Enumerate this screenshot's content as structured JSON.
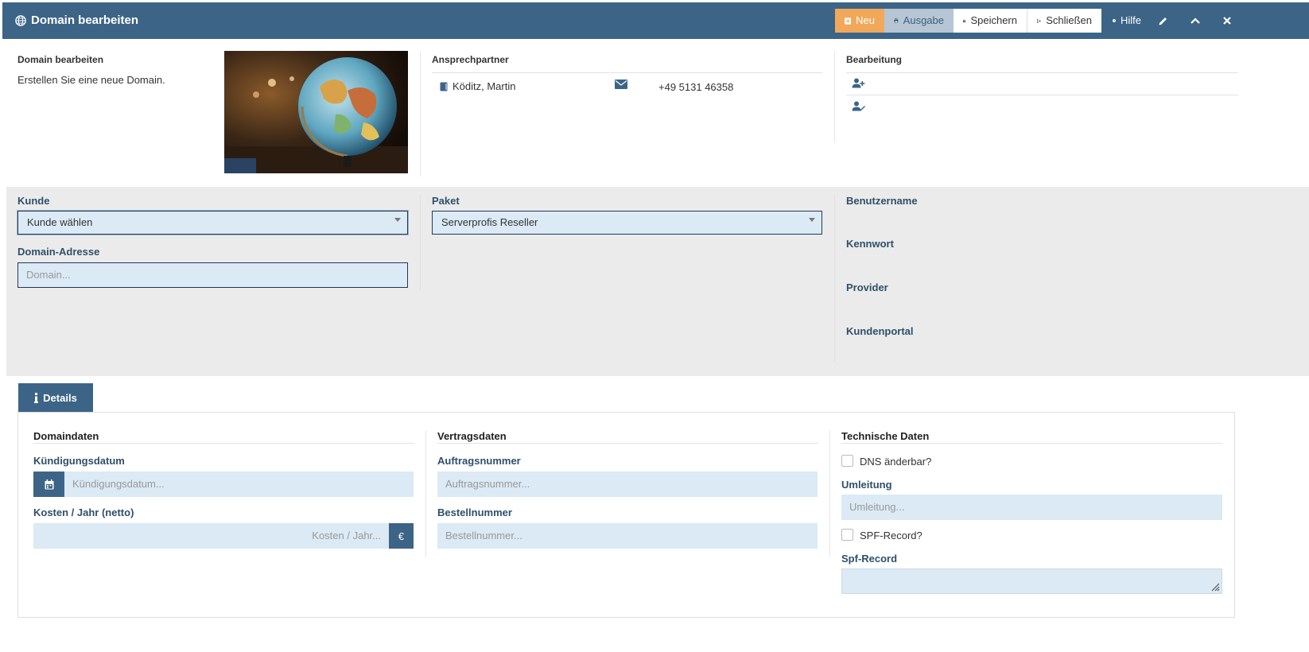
{
  "window": {
    "title": "Domain bearbeiten",
    "buttons": {
      "neu": "Neu",
      "ausgabe": "Ausgabe",
      "speichern": "Speichern",
      "schliessen": "Schließen",
      "hilfe": "Hilfe"
    }
  },
  "info": {
    "heading": "Domain bearbeiten",
    "description": "Erstellen Sie eine neue Domain.",
    "contact_heading": "Ansprechpartner",
    "contact_name": "Köditz, Martin",
    "contact_phone": "+49 5131 46358",
    "editing_heading": "Bearbeitung"
  },
  "form": {
    "kunde_label": "Kunde",
    "kunde_value": "Kunde wählen",
    "domain_label": "Domain-Adresse",
    "domain_placeholder": "Domain...",
    "paket_label": "Paket",
    "paket_value": "Serverprofis Reseller",
    "benutzername_label": "Benutzername",
    "kennwort_label": "Kennwort",
    "provider_label": "Provider",
    "kundenportal_label": "Kundenportal"
  },
  "tabs": [
    {
      "label": "Details"
    }
  ],
  "details": {
    "domaindaten": {
      "title": "Domaindaten",
      "kuendigung_label": "Kündigungsdatum",
      "kuendigung_placeholder": "Kündigungsdatum...",
      "kosten_label": "Kosten / Jahr (netto)",
      "kosten_placeholder": "Kosten / Jahr...",
      "currency": "€"
    },
    "vertragsdaten": {
      "title": "Vertragsdaten",
      "auftrag_label": "Auftragsnummer",
      "auftrag_placeholder": "Auftragsnummer...",
      "bestell_label": "Bestellnummer",
      "bestell_placeholder": "Bestellnummer..."
    },
    "technische": {
      "title": "Technische Daten",
      "dns_label": "DNS änderbar?",
      "umleitung_label": "Umleitung",
      "umleitung_placeholder": "Umleitung...",
      "spf_check_label": "SPF-Record?",
      "spf_label": "Spf-Record"
    }
  },
  "colors": {
    "header": "#3c6487",
    "accent_orange": "#f2a85a",
    "input_bg": "#dbeaf5",
    "grey_area": "#ebebeb"
  }
}
